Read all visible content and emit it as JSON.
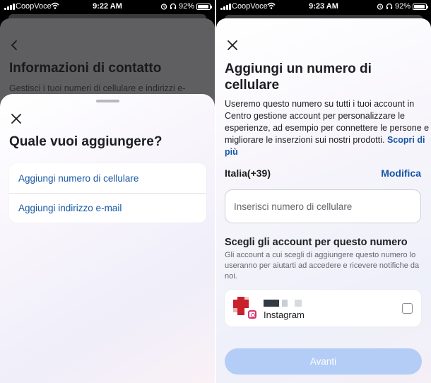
{
  "left": {
    "status": {
      "carrier": "CoopVoce",
      "time": "9:22 AM",
      "battery": "92%"
    },
    "background": {
      "title": "Informazioni di contatto",
      "subtitle": "Gestisci i tuoi numeri di cellulare e indirizzi e-"
    },
    "modal": {
      "title": "Quale vuoi aggiungere?",
      "options": [
        "Aggiungi numero di cellulare",
        "Aggiungi indirizzo e-mail"
      ]
    }
  },
  "right": {
    "status": {
      "carrier": "CoopVoce",
      "time": "9:23 AM",
      "battery": "92%"
    },
    "title": "Aggiungi un numero di cellulare",
    "description": "Useremo questo numero su tutti i tuoi account in Centro gestione account per personalizzare le esperienze, ad esempio per connettere le persone e migliorare le inserzioni sui nostri prodotti.",
    "learn_more": "Scopri di più",
    "country": "Italia(+39)",
    "edit_label": "Modifica",
    "phone_placeholder": "Inserisci numero di cellulare",
    "accounts_title": "Scegli gli account per questo numero",
    "accounts_description": "Gli account a cui scegli di aggiungere questo numero lo useranno per aiutarti ad accedere e ricevere notifiche da noi.",
    "account": {
      "app": "Instagram",
      "checked": false
    },
    "next_button": "Avanti"
  },
  "colors": {
    "link": "#1656a4",
    "button_disabled": "#b3cdf6",
    "instagram": "#d6336c"
  },
  "icons": [
    "signal-icon",
    "wifi-icon",
    "alarm-icon",
    "headphones-icon",
    "battery-icon",
    "back-chevron-icon",
    "close-icon",
    "instagram-icon"
  ]
}
